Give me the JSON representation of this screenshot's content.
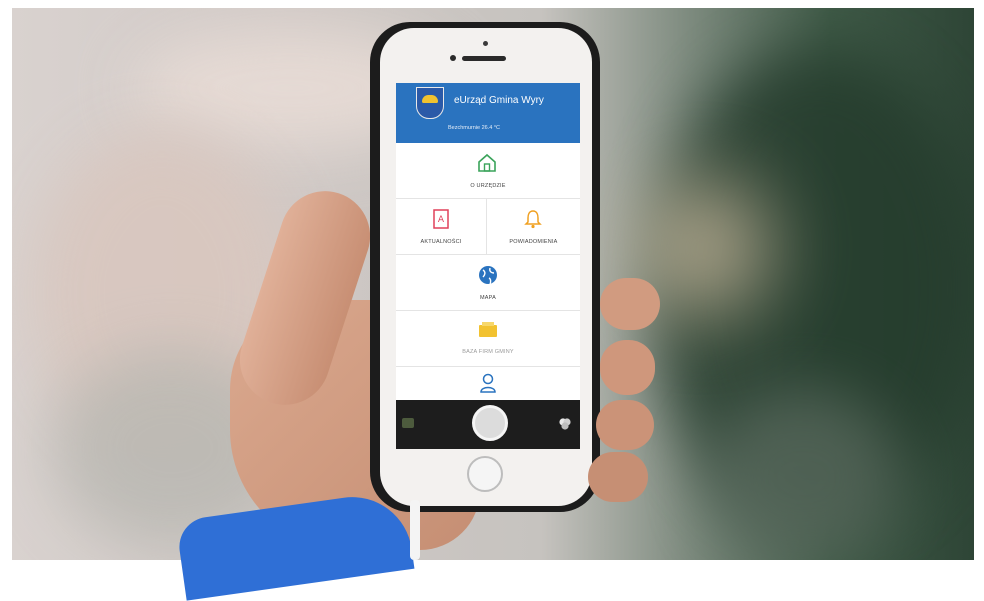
{
  "app": {
    "title": "eUrząd Gmina Wyry",
    "weather": "Bezchmurnie 26.4 °C"
  },
  "tiles": [
    {
      "label": "O URZĘDZIE",
      "icon": "home-icon",
      "color": "#3aa35a"
    },
    {
      "label": "AKTUALNOŚCI",
      "icon": "news-icon",
      "color": "#e0405a"
    },
    {
      "label": "POWIADOMIENIA",
      "icon": "bell-icon",
      "color": "#f0a020"
    },
    {
      "label": "MAPA",
      "icon": "globe-icon",
      "color": "#2a73bf"
    },
    {
      "label": "BAZA FIRM GMINY",
      "icon": "card-icon",
      "color": "#f2c230"
    },
    {
      "label": "",
      "icon": "user-icon",
      "color": "#2a73bf"
    }
  ],
  "colors": {
    "header": "#2a73bf",
    "sleeve": "#2f6fd6"
  }
}
